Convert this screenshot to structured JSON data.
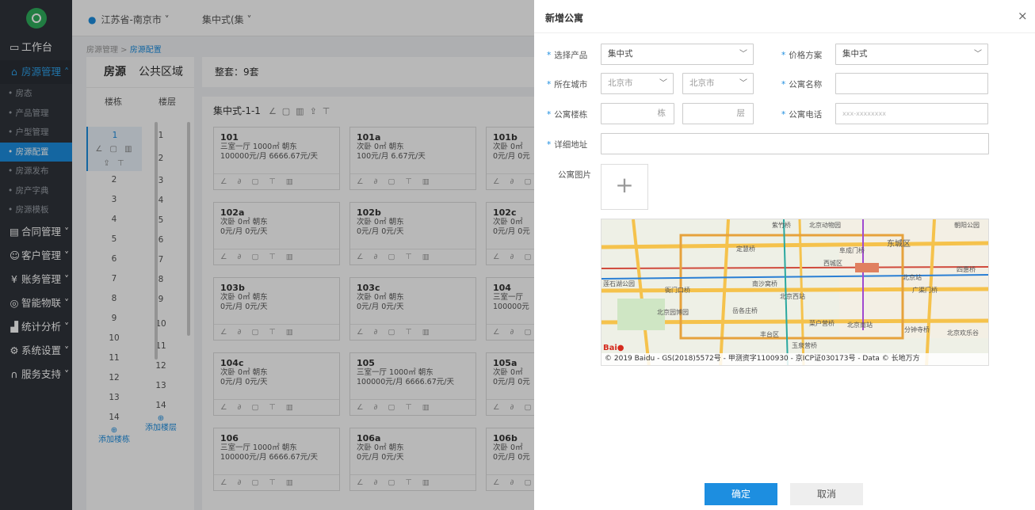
{
  "sidebar": {
    "workbench": "工作台",
    "property_mgmt": "房源管理",
    "sub_items": [
      "房态",
      "产品管理",
      "户型管理",
      "房源配置",
      "房源发布",
      "房产字典",
      "房源模板"
    ],
    "groups": [
      "合同管理",
      "客户管理",
      "账务管理",
      "智能物联",
      "统计分析",
      "系统设置",
      "服务支持"
    ]
  },
  "topbar": {
    "location": "江苏省-南京市",
    "mode": "集中式(集"
  },
  "breadcrumb": {
    "parent": "房源管理",
    "current": "房源配置"
  },
  "left_panel": {
    "tabs": [
      "房源",
      "公共区域"
    ],
    "col_building": "楼栋",
    "col_floor": "楼层",
    "buildings": [
      "1",
      "2",
      "3",
      "4",
      "5",
      "6",
      "7",
      "8",
      "9",
      "10",
      "11",
      "12",
      "13",
      "14"
    ],
    "floors": [
      "1",
      "2",
      "3",
      "4",
      "5",
      "6",
      "7",
      "8",
      "9",
      "10",
      "11",
      "12",
      "13",
      "14"
    ],
    "add_building": "添加楼栋",
    "add_floor": "添加楼层"
  },
  "right_panel": {
    "summary": "整套：9套",
    "floor_title": "集中式-1-1",
    "cards": [
      {
        "no": "101",
        "l1": "三室一厅  1000㎡  朝东",
        "l2": "100000元/月  6666.67元/天"
      },
      {
        "no": "101a",
        "l1": "次卧  0㎡  朝东",
        "l2": "100元/月  6.67元/天"
      },
      {
        "no": "101b",
        "l1": "次卧  0㎡",
        "l2": "0元/月  0元"
      },
      {
        "no": "102a",
        "l1": "次卧  0㎡  朝东",
        "l2": "0元/月  0元/天"
      },
      {
        "no": "102b",
        "l1": "次卧  0㎡  朝东",
        "l2": "0元/月  0元/天"
      },
      {
        "no": "102c",
        "l1": "次卧  0㎡",
        "l2": "0元/月  0元"
      },
      {
        "no": "103b",
        "l1": "次卧  0㎡  朝东",
        "l2": "0元/月  0元/天"
      },
      {
        "no": "103c",
        "l1": "次卧  0㎡  朝东",
        "l2": "0元/月  0元/天"
      },
      {
        "no": "104",
        "l1": "三室一厅",
        "l2": "100000元"
      },
      {
        "no": "104c",
        "l1": "次卧  0㎡  朝东",
        "l2": "0元/月  0元/天"
      },
      {
        "no": "105",
        "l1": "三室一厅  1000㎡  朝东",
        "l2": "100000元/月  6666.67元/天"
      },
      {
        "no": "105a",
        "l1": "次卧  0㎡",
        "l2": "0元/月  0元"
      },
      {
        "no": "106",
        "l1": "三室一厅  1000㎡  朝东",
        "l2": "100000元/月  6666.67元/天"
      },
      {
        "no": "106a",
        "l1": "次卧  0㎡  朝东",
        "l2": "0元/月  0元/天"
      },
      {
        "no": "106b",
        "l1": "次卧  0㎡",
        "l2": "0元/月  0元"
      }
    ]
  },
  "dialog": {
    "title": "新增公寓",
    "close": "×",
    "label_product": "选择产品",
    "product_value": "集中式",
    "label_price_plan": "价格方案",
    "price_plan_value": "集中式",
    "label_city": "所在城市",
    "city_province": "北京市",
    "city_city": "北京市",
    "label_name": "公寓名称",
    "label_building": "公寓楼栋",
    "unit_building": "栋",
    "unit_floor": "层",
    "label_phone": "公寓电话",
    "phone_placeholder": "xxx-xxxxxxxx",
    "label_address": "详细地址",
    "label_image": "公寓图片",
    "map_credit": "© 2019 Baidu - GS(2018)5572号 - 甲测资字1100930 - 京ICP证030173号 - Data © 长地万方",
    "map_labels": [
      "紫竹桥",
      "北京动物园",
      "东城区",
      "西城区",
      "北京站",
      "广渠门桥",
      "南沙窝桥",
      "北京西站",
      "北京园博园",
      "岳各庄桥",
      "菜户营桥",
      "北京南站",
      "丰台区",
      "玉泉营桥",
      "分钟寺桥",
      "北京欢乐谷",
      "莲石湖公园",
      "衙门口桥",
      "四惠桥",
      "朝阳公园",
      "定慧桥",
      "阜成门桥"
    ],
    "ok": "确定",
    "cancel": "取消"
  }
}
